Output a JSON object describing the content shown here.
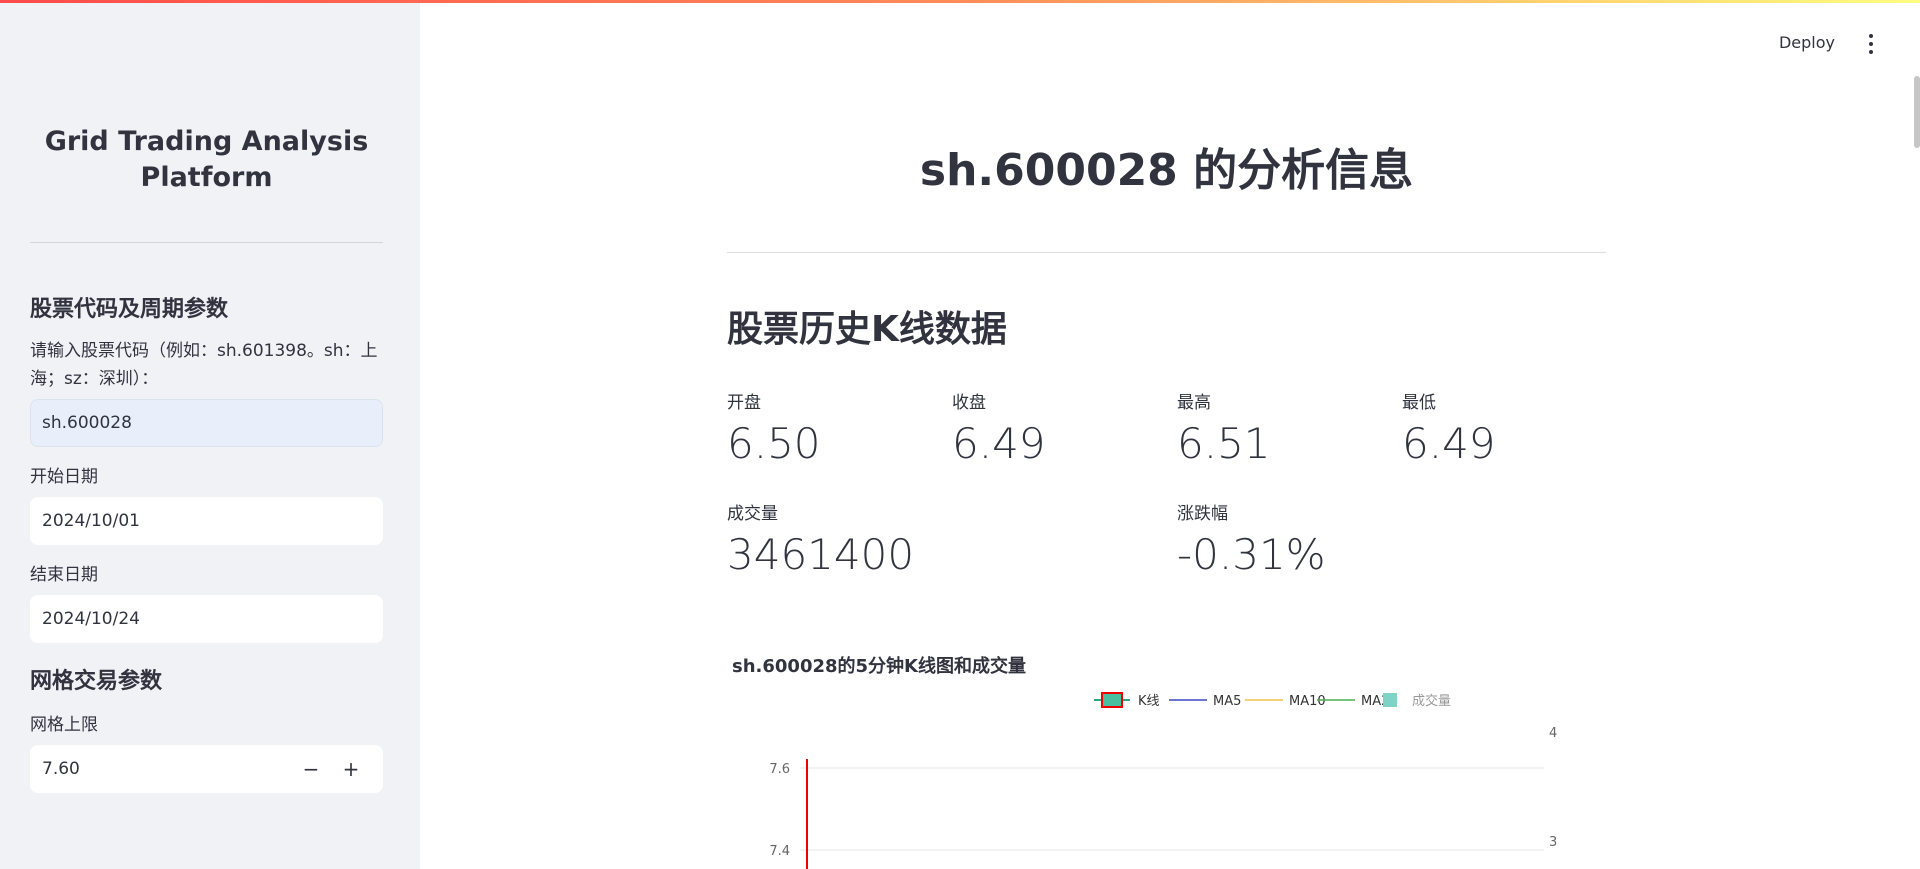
{
  "sidebar": {
    "title_line1": "Grid Trading Analysis",
    "title_line2": "Platform",
    "stock_section": {
      "header": "股票代码及周期参数",
      "code_label": "请输入股票代码（例如：sh.601398。sh：上海；sz：深圳）：",
      "code_value": "sh.600028",
      "start_label": "开始日期",
      "start_value": "2024/10/01",
      "end_label": "结束日期",
      "end_value": "2024/10/24"
    },
    "grid_section": {
      "header": "网格交易参数",
      "upper_label": "网格上限",
      "upper_value": "7.60",
      "minus": "−",
      "plus": "+"
    }
  },
  "header": {
    "deploy": "Deploy"
  },
  "main": {
    "title": "sh.600028 的分析信息",
    "subheading": "股票历史K线数据",
    "metrics": [
      {
        "label": "开盘",
        "value": "6.50"
      },
      {
        "label": "收盘",
        "value": "6.49"
      },
      {
        "label": "最高",
        "value": "6.51"
      },
      {
        "label": "最低",
        "value": "6.49"
      },
      {
        "label": "成交量",
        "value": "3461400"
      },
      {
        "label": "涨跌幅",
        "value": "-0.31%"
      }
    ]
  },
  "chart_data": {
    "type": "line",
    "title": "sh.600028的5分钟K线图和成交量",
    "legend": [
      "K线",
      "MA5",
      "MA10",
      "MA20",
      "成交量"
    ],
    "legend_colors": [
      "#ec0000",
      "#3a47c0",
      "#f2c14e",
      "#4caf50",
      "#7fd3c4"
    ],
    "y_ticks_left": [
      "7.6",
      "7.4"
    ],
    "y_ticks_right": [
      "4",
      "3"
    ],
    "legend_position": "top-right",
    "grid": true
  },
  "colors": {
    "accent": "#ff4b4b",
    "sidebar_bg": "#f0f2f6",
    "candle_up": "#ec0000"
  }
}
